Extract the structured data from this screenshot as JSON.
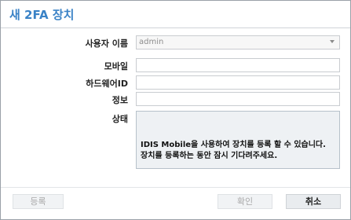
{
  "dialog": {
    "title": "새 2FA 장치"
  },
  "form": {
    "username_label": "사용자 이름",
    "username_value": "admin",
    "mobile_label": "모바일",
    "mobile_value": "",
    "hardware_id_label": "하드웨어ID",
    "hardware_id_value": "",
    "info_label": "정보",
    "info_value": "",
    "status_label": "상태",
    "status_line1": "IDIS Mobile을 사용하여 장치를 등록 할 수 있습니다.",
    "status_line2": "장치를 등록하는 동안 잠시 기다려주세요."
  },
  "buttons": {
    "register": "등록",
    "confirm": "확인",
    "cancel": "취소"
  },
  "icons": {
    "dropdown": "chevron-down-icon"
  },
  "colors": {
    "title": "#3a82c6",
    "disabled_text": "#aaaaaa"
  }
}
